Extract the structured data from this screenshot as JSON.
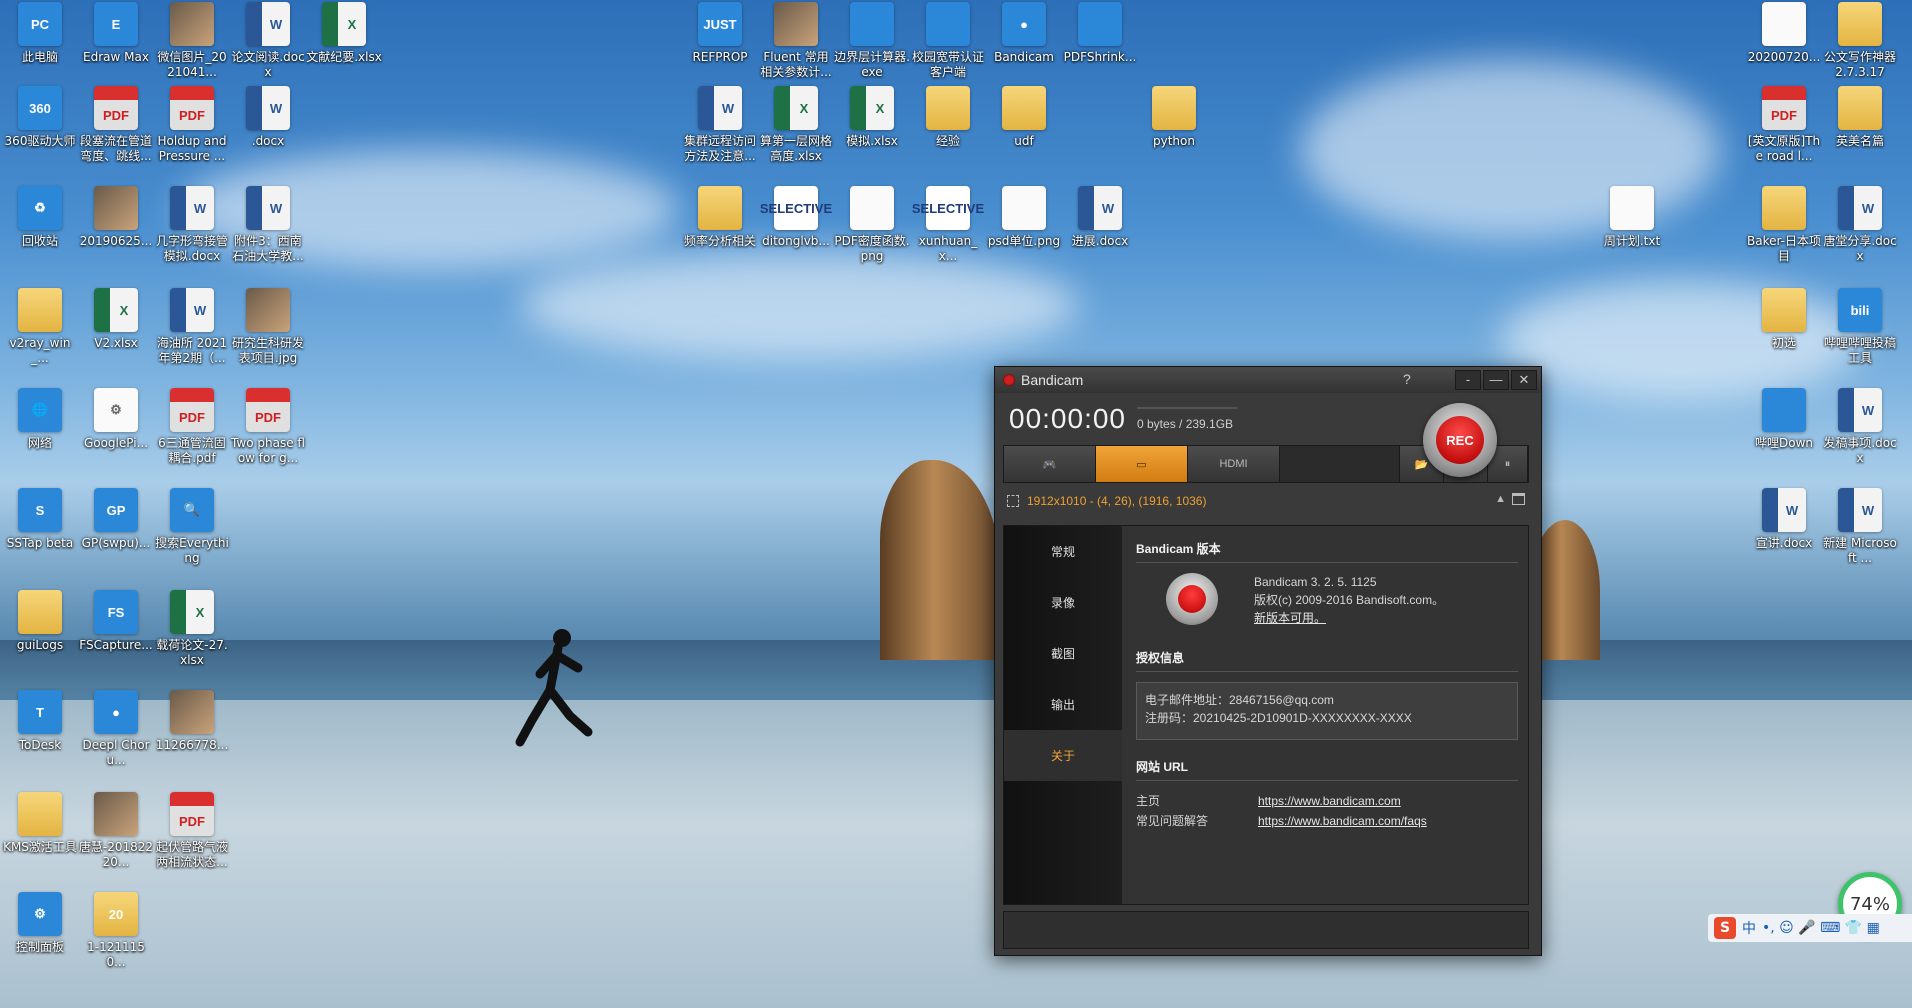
{
  "desktop": {
    "icons": [
      {
        "label": "此电脑",
        "glyph": "PC",
        "kind": "app"
      },
      {
        "label": "Edraw Max",
        "glyph": "E",
        "kind": "app"
      },
      {
        "label": "微信图片_2021041...",
        "glyph": "",
        "kind": "img"
      },
      {
        "label": "论文阅读.docx",
        "glyph": "W",
        "kind": "word"
      },
      {
        "label": "文献纪要.xlsx",
        "glyph": "X",
        "kind": "xls"
      },
      {
        "label": "360驱动大师",
        "glyph": "360",
        "kind": "app"
      },
      {
        "label": "段塞流在管道弯度、跳线...",
        "glyph": "PDF",
        "kind": "pdf"
      },
      {
        "label": "Holdup and Pressure ...",
        "glyph": "PDF",
        "kind": "pdf"
      },
      {
        "label": ".docx",
        "glyph": "W",
        "kind": "word"
      },
      {
        "label": "回收站",
        "glyph": "♻",
        "kind": "app"
      },
      {
        "label": "20190625...",
        "glyph": "",
        "kind": "img"
      },
      {
        "label": "几字形弯接管模拟.docx",
        "glyph": "W",
        "kind": "word"
      },
      {
        "label": "附件3：西南石油大学教...",
        "glyph": "W",
        "kind": "word"
      },
      {
        "label": "v2ray_win_...",
        "glyph": "",
        "kind": "folder"
      },
      {
        "label": "V2.xlsx",
        "glyph": "X",
        "kind": "xls"
      },
      {
        "label": "海油所 2021年第2期（...",
        "glyph": "W",
        "kind": "word"
      },
      {
        "label": "研究生科研发表项目.jpg",
        "glyph": "",
        "kind": "img"
      },
      {
        "label": "网络",
        "glyph": "🌐",
        "kind": "app"
      },
      {
        "label": "GooglePi...",
        "glyph": "⚙",
        "kind": "txt"
      },
      {
        "label": "6三通管流固耦合.pdf",
        "glyph": "PDF",
        "kind": "pdf"
      },
      {
        "label": "Two phase flow for g...",
        "glyph": "PDF",
        "kind": "pdf"
      },
      {
        "label": "SSTap beta",
        "glyph": "S",
        "kind": "app"
      },
      {
        "label": "GP(swpu)...",
        "glyph": "GP",
        "kind": "app"
      },
      {
        "label": "搜索Everything",
        "glyph": "🔍",
        "kind": "app"
      },
      {
        "label": "guiLogs",
        "glyph": "",
        "kind": "folder"
      },
      {
        "label": "FSCapture...",
        "glyph": "FS",
        "kind": "app"
      },
      {
        "label": "载荷论文-27.xlsx",
        "glyph": "X",
        "kind": "xls"
      },
      {
        "label": "ToDesk",
        "glyph": "T",
        "kind": "app"
      },
      {
        "label": "Deepl Choru...",
        "glyph": "●",
        "kind": "app"
      },
      {
        "label": "11266778...",
        "glyph": "",
        "kind": "img"
      },
      {
        "label": "KMS激活工具",
        "glyph": "",
        "kind": "folder"
      },
      {
        "label": "唐慧-20182220...",
        "glyph": "",
        "kind": "img"
      },
      {
        "label": "起伏管路气液两相流状态...",
        "glyph": "PDF",
        "kind": "pdf"
      },
      {
        "label": "控制面板",
        "glyph": "⚙",
        "kind": "app"
      },
      {
        "label": "1-1211150...",
        "glyph": "20",
        "kind": "folder"
      },
      {
        "label": "REFPROP",
        "glyph": "JUST",
        "kind": "app"
      },
      {
        "label": "Fluent 常用相关参数计...",
        "glyph": "",
        "kind": "img"
      },
      {
        "label": "边界层计算器.exe",
        "glyph": "",
        "kind": "app"
      },
      {
        "label": "校园宽带认证客户端",
        "glyph": "",
        "kind": "app"
      },
      {
        "label": "Bandicam",
        "glyph": "●",
        "kind": "app"
      },
      {
        "label": "PDFShrink...",
        "glyph": "",
        "kind": "app"
      },
      {
        "label": "集群远程访问方法及注意...",
        "glyph": "W",
        "kind": "word"
      },
      {
        "label": "算第一层网格高度.xlsx",
        "glyph": "X",
        "kind": "xls"
      },
      {
        "label": "模拟.xlsx",
        "glyph": "X",
        "kind": "xls"
      },
      {
        "label": "经验",
        "glyph": "",
        "kind": "folder"
      },
      {
        "label": "udf",
        "glyph": "",
        "kind": "folder"
      },
      {
        "label": "python",
        "glyph": "",
        "kind": "folder"
      },
      {
        "label": "频率分析相关",
        "glyph": "",
        "kind": "folder"
      },
      {
        "label": "ditonglvb...",
        "glyph": "SELECTIVE",
        "kind": "sel"
      },
      {
        "label": "PDF密度函数.png",
        "glyph": "",
        "kind": "txt"
      },
      {
        "label": "xunhuan_x...",
        "glyph": "SELECTIVE",
        "kind": "sel"
      },
      {
        "label": "psd单位.png",
        "glyph": "",
        "kind": "txt"
      },
      {
        "label": "进展.docx",
        "glyph": "W",
        "kind": "word"
      },
      {
        "label": "20200720...",
        "glyph": "",
        "kind": "txt"
      },
      {
        "label": "公文写作神器2.7.3.17",
        "glyph": "",
        "kind": "folder"
      },
      {
        "label": "[英文原版]The road l...",
        "glyph": "PDF",
        "kind": "pdf"
      },
      {
        "label": "英美名篇",
        "glyph": "",
        "kind": "folder"
      },
      {
        "label": "周计划.txt",
        "glyph": "",
        "kind": "txt"
      },
      {
        "label": "Baker-日本项目",
        "glyph": "",
        "kind": "folder"
      },
      {
        "label": "唐堂分享.docx",
        "glyph": "W",
        "kind": "word"
      },
      {
        "label": "初选",
        "glyph": "",
        "kind": "folder"
      },
      {
        "label": "哔哩哔哩投稿工具",
        "glyph": "bili",
        "kind": "app"
      },
      {
        "label": "哔哩Down",
        "glyph": "",
        "kind": "app"
      },
      {
        "label": "发稿事项.docx",
        "glyph": "W",
        "kind": "word"
      },
      {
        "label": "宣讲.docx",
        "glyph": "W",
        "kind": "word"
      },
      {
        "label": "新建 Microsoft ...",
        "glyph": "W",
        "kind": "word"
      }
    ]
  },
  "bandicam": {
    "title": "Bandicam",
    "help": "?",
    "btn_min_small": "-",
    "btn_min": "—",
    "btn_close": "✕",
    "timer": "00:00:00",
    "size": "0 bytes / 239.1GB",
    "rec_label": "REC",
    "toolbar": {
      "game_icon": "🎮",
      "screen_icon": "▭",
      "hdmi_label": "HDMI",
      "folder_icon": "📂",
      "camera_icon": "📷",
      "pause_icon": "⏸"
    },
    "region": "1912x1010 - (4, 26), (1916, 1036)",
    "region_up": "▲",
    "sidebar": [
      "常规",
      "录像",
      "截图",
      "输出",
      "关于"
    ],
    "about": {
      "version_header": "Bandicam 版本",
      "version": "Bandicam 3. 2. 5. 1125",
      "copyright": "版权(c) 2009-2016 Bandisoft.com。",
      "update_link": "新版本可用。",
      "license_header": "授权信息",
      "email": "电子邮件地址：28467156@qq.com",
      "serial": "注册码：20210425-2D10901D-XXXXXXXX-XXXX",
      "url_header": "网站 URL",
      "home_label": "主页",
      "home_url": "https://www.bandicam.com",
      "faq_label": "常见问题解答",
      "faq_url": "https://www.bandicam.com/faqs"
    }
  },
  "tray": {
    "ime_logo": "S",
    "ime_mode": "中",
    "icons": "•, ☺ 🎤 ⌨ 👕 ▦",
    "gauge": "74%"
  }
}
